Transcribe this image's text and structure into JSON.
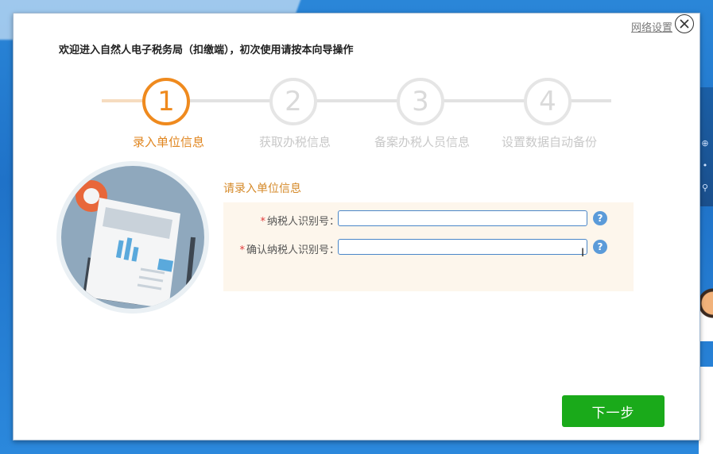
{
  "dialog": {
    "network_settings": "网络设置",
    "welcome": "欢迎进入自然人电子税务局（扣缴端），初次使用请按本向导操作"
  },
  "steps": [
    {
      "number": "1",
      "label": "录入单位信息",
      "active": true
    },
    {
      "number": "2",
      "label": "获取办税信息",
      "active": false
    },
    {
      "number": "3",
      "label": "备案办税人员信息",
      "active": false
    },
    {
      "number": "4",
      "label": "设置数据自动备份",
      "active": false
    }
  ],
  "form": {
    "title": "请录入单位信息",
    "fields": [
      {
        "required_mark": "*",
        "label": "纳税人识别号：",
        "value": "",
        "help": "?"
      },
      {
        "required_mark": "*",
        "label": "确认纳税人识别号：",
        "value": "",
        "help": "?"
      }
    ]
  },
  "buttons": {
    "next": "下一步"
  },
  "icons": {
    "close": "close-icon",
    "help": "question-mark-icon",
    "illustration": "document-illustration"
  },
  "colors": {
    "accent_orange": "#ef8a1e",
    "primary_green": "#1aaa1a",
    "help_blue": "#5b9bd9",
    "required_red": "#e03a3a"
  }
}
